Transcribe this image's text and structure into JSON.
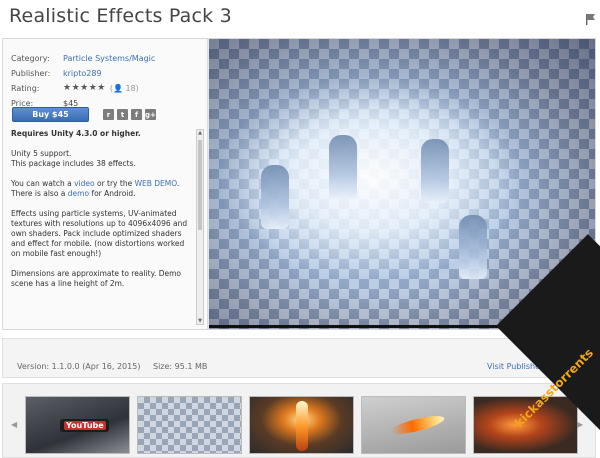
{
  "page": {
    "title": "Realistic Effects Pack 3"
  },
  "details": [
    {
      "label": "Category:",
      "value": "Particle Systems/Magic"
    },
    {
      "label": "Publisher:",
      "value": "kripto289"
    },
    {
      "label": "Rating:",
      "value": "★★★★★",
      "count": "(👤 18)"
    },
    {
      "label": "Price:",
      "value": "$45"
    }
  ],
  "buy_label": "Buy $45",
  "share_icons": [
    "reddit-icon",
    "twitter-icon",
    "facebook-icon",
    "googleplus-icon"
  ],
  "description": {
    "requires": "Requires Unity 4.3.0 or higher.",
    "line1": "Unity 5 support.",
    "line2": "This package includes 38 effects.",
    "demo_pre": "You can watch a ",
    "demo_video": "video",
    "demo_mid": " or try the ",
    "demo_web": "WEB DEMO",
    "demo_post": ".",
    "android_pre": "There is also a ",
    "android_link": "demo",
    "android_post": " for Android.",
    "para3": "Effects using particle systems, UV-animated textures with resolutions up to 4096x4096 and own shaders. Pack include optimized shaders and effect for mobile. (now distortions worked on mobile fast enough!)",
    "para4": "Dimensions are approximate to reality. Demo scene has a line height of 2m."
  },
  "version_info": "Version: 1.1.0.0 (Apr 16, 2015)",
  "size_info": "Size: 95.1 MB",
  "publisher_site": "Visit Publisher's We",
  "youtube_label": "YouTube",
  "watermark": "kickasstorrents"
}
